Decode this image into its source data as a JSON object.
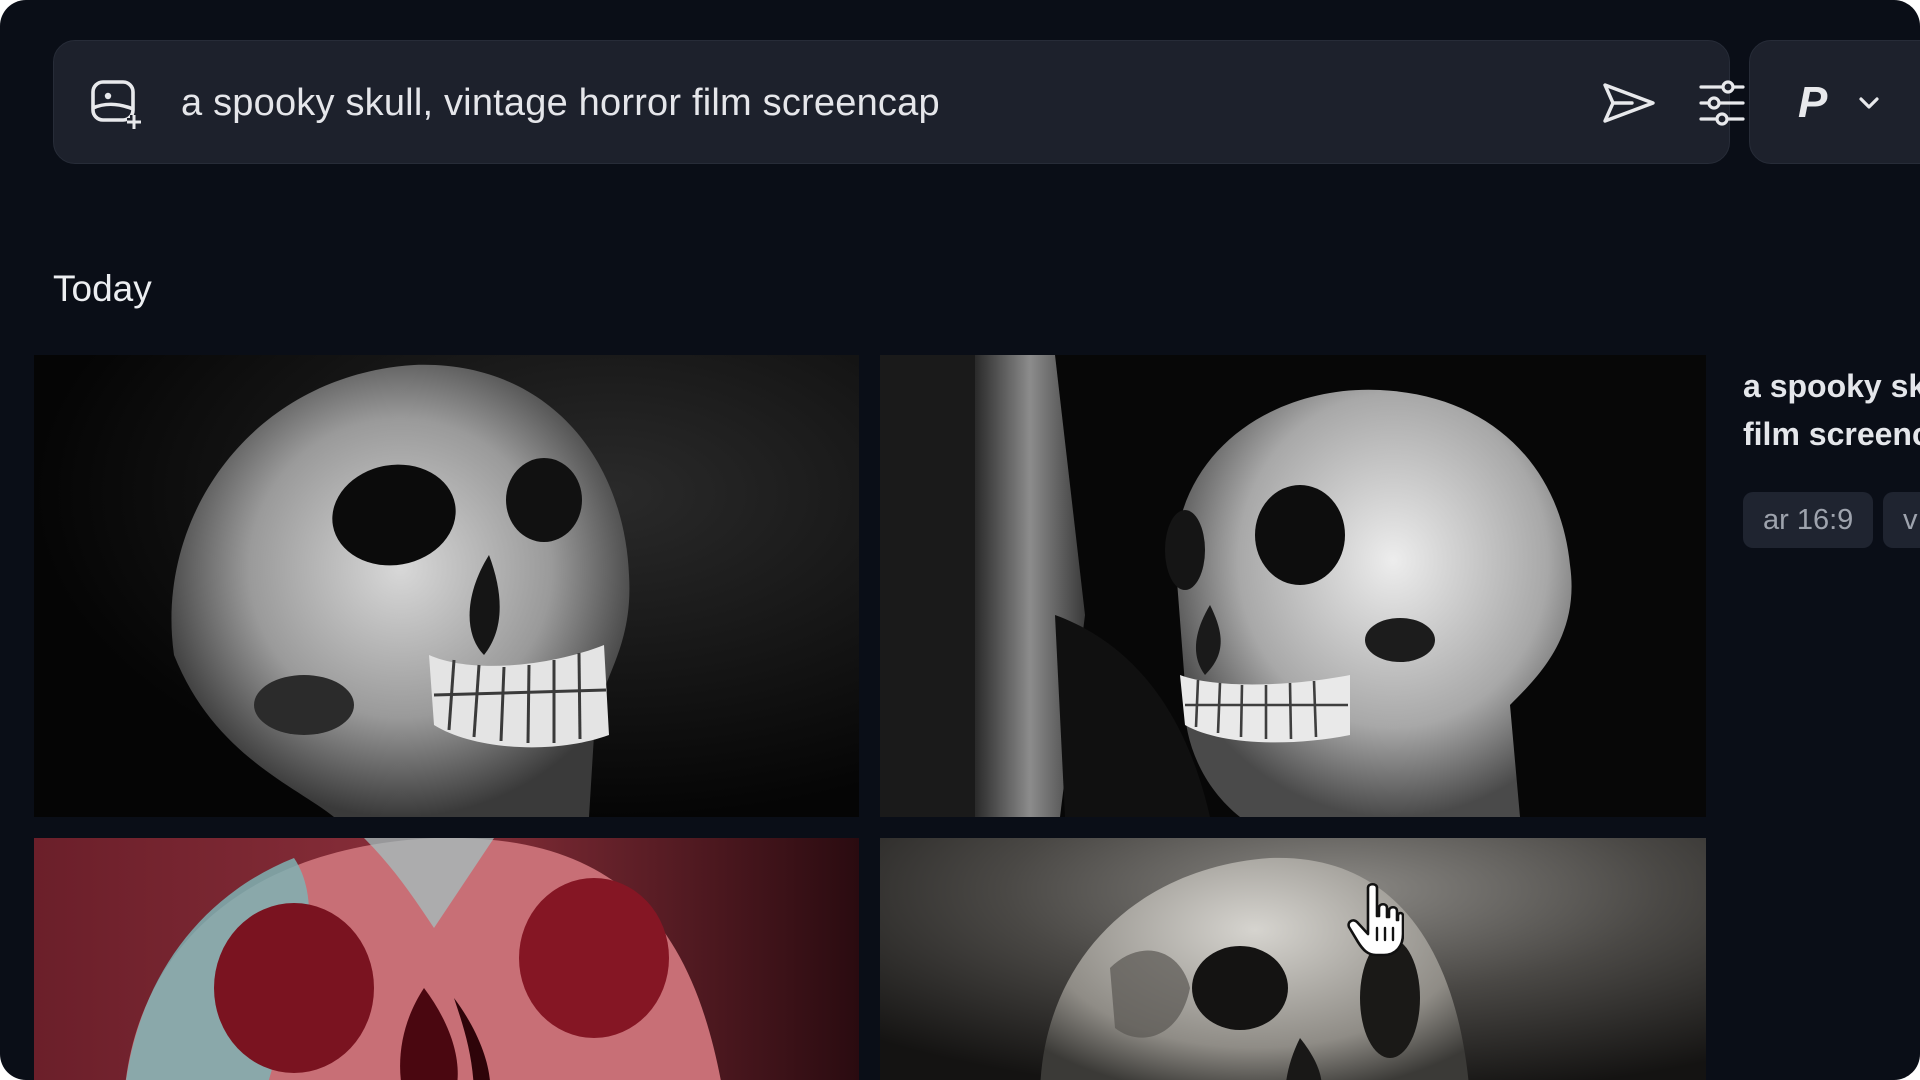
{
  "prompt_bar": {
    "prompt_text": "a spooky skull, vintage horror film screencap",
    "icons": [
      "add-image-icon",
      "send-icon",
      "settings-sliders-icon"
    ]
  },
  "model_picker": {
    "letter": "P",
    "icon": "chevron-down-icon"
  },
  "feed": {
    "section_title": "Today"
  },
  "detail": {
    "prompt_line_1": "a spooky sk",
    "prompt_line_2": "film screenc",
    "chips": [
      "ar 16:9",
      "v"
    ]
  },
  "colors": {
    "background": "#0a0e17",
    "panel": "#1d212c",
    "chip": "#1f2430",
    "text": "#e5e6ea",
    "muted_text": "#9ea3ad"
  }
}
